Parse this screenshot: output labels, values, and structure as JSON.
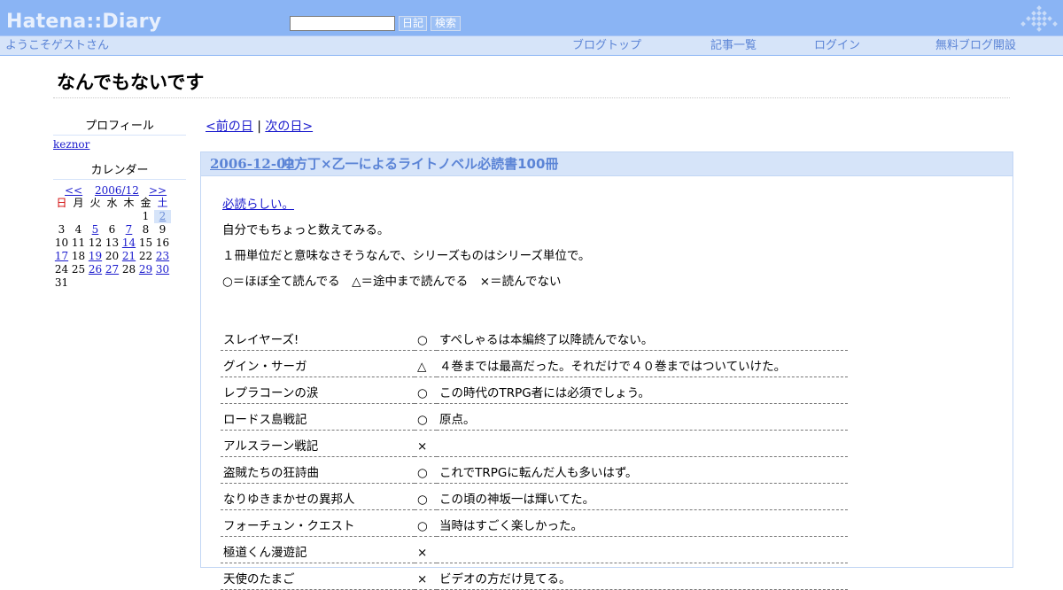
{
  "topbar": {
    "logo": "Hatena::Diary",
    "search_placeholder": "",
    "diary_button": "日記",
    "search_button": "検索"
  },
  "subbar": {
    "welcome": "ようこそゲストさん",
    "blog_top": "ブログトップ",
    "article_list": "記事一覧",
    "login": "ログイン",
    "create_blog": "無料ブログ開設"
  },
  "page_title": "なんでもないです",
  "sidebar": {
    "profile_heading": "プロフィール",
    "profile_user": "keznor",
    "calendar_heading": "カレンダー",
    "prev": "<<",
    "month": "2006/12",
    "next": ">>",
    "weekdays": [
      "日",
      "月",
      "火",
      "水",
      "木",
      "金",
      "土"
    ],
    "weeks": [
      [
        "",
        "",
        "",
        "",
        "",
        "1",
        "2"
      ],
      [
        "3",
        "4",
        "5",
        "6",
        "7",
        "8",
        "9"
      ],
      [
        "10",
        "11",
        "12",
        "13",
        "14",
        "15",
        "16"
      ],
      [
        "17",
        "18",
        "19",
        "20",
        "21",
        "22",
        "23"
      ],
      [
        "24",
        "25",
        "26",
        "27",
        "28",
        "29",
        "30"
      ],
      [
        "31",
        "",
        "",
        "",
        "",
        "",
        ""
      ]
    ],
    "linked_days": [
      "2",
      "5",
      "7",
      "14",
      "17",
      "19",
      "21",
      "23",
      "26",
      "27",
      "29",
      "30"
    ],
    "today": "2"
  },
  "day_nav": {
    "prev": "<前の日",
    "separator": "|",
    "next": "次の日>"
  },
  "entry": {
    "date": "2006-12-02",
    "title": "冲方丁×乙一によるライトノベル必読書100冊",
    "link_text": "必読らしい。",
    "p1": "自分でもちょっと数えてみる。",
    "p2": "１冊単位だと意味なさそうなんで、シリーズものはシリーズ単位で。",
    "p3": "○＝ほぼ全て読んでる　△＝途中まで読んでる　×＝読んでない"
  },
  "books": [
    {
      "title": "スレイヤーズ!",
      "mark": "○",
      "comment": "すぺしゃるは本編終了以降読んでない。"
    },
    {
      "title": "グイン・サーガ",
      "mark": "△",
      "comment": "４巻までは最高だった。それだけで４０巻まではついていけた。"
    },
    {
      "title": "レプラコーンの涙",
      "mark": "○",
      "comment": "この時代のTRPG者には必須でしょう。"
    },
    {
      "title": "ロードス島戦記",
      "mark": "○",
      "comment": "原点。"
    },
    {
      "title": "アルスラーン戦記",
      "mark": "×",
      "comment": ""
    },
    {
      "title": "盗賊たちの狂詩曲",
      "mark": "○",
      "comment": "これでTRPGに転んだ人も多いはず。"
    },
    {
      "title": "なりゆきまかせの異邦人",
      "mark": "○",
      "comment": "この頃の神坂一は輝いてた。"
    },
    {
      "title": "フォーチュン・クエスト",
      "mark": "○",
      "comment": "当時はすごく楽しかった。"
    },
    {
      "title": "極道くん漫遊記",
      "mark": "×",
      "comment": ""
    },
    {
      "title": "天使のたまご",
      "mark": "×",
      "comment": "ビデオの方だけ見てる。"
    }
  ],
  "colors": {
    "topbar": "#8ab4f4",
    "subbar": "#d6e4f9",
    "accent": "#5b84d6",
    "link": "#1a1acd"
  }
}
